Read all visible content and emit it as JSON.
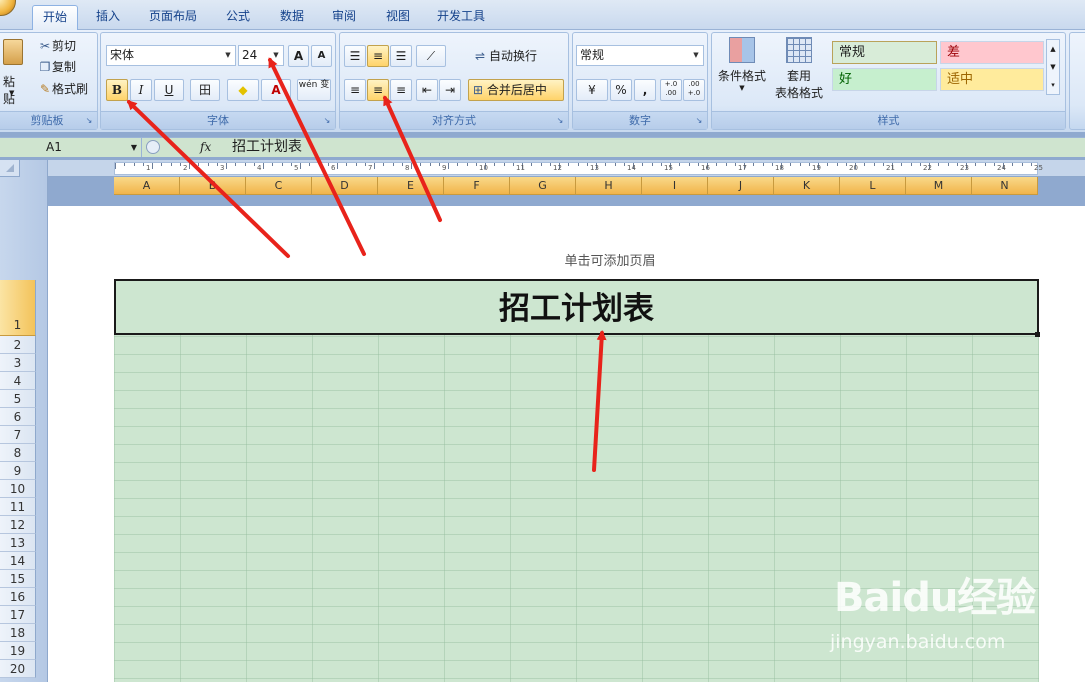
{
  "tabs": [
    "开始",
    "插入",
    "页面布局",
    "公式",
    "数据",
    "审阅",
    "视图",
    "开发工具"
  ],
  "clipboard": {
    "paste": "粘贴",
    "cut": "剪切",
    "copy": "复制",
    "format_painter": "格式刷",
    "label": "剪贴板"
  },
  "font": {
    "name": "宋体",
    "size": "24",
    "grow": "A",
    "shrink": "A",
    "bold": "B",
    "italic": "I",
    "underline": "U",
    "border": "田",
    "fill": "◆",
    "color": "A",
    "phonetic": "wén 变",
    "label": "字体"
  },
  "alignment": {
    "wrap_text": "自动换行",
    "merge_center": "合并后居中",
    "label": "对齐方式"
  },
  "number": {
    "format": "常规",
    "percent": "%",
    "comma": ",",
    "inc_decimal": "+.0 .00",
    "dec_decimal": ".00 +.0",
    "label": "数字"
  },
  "styles": {
    "conditional": "条件格式",
    "table_format_1": "套用",
    "table_format_2": "表格格式",
    "normal": "常规",
    "bad": "差",
    "good": "好",
    "neutral": "适中",
    "label": "样式"
  },
  "formula_bar": {
    "cell_ref": "A1",
    "fx": "fx",
    "content": "招工计划表"
  },
  "ruler_numbers": [
    "1",
    "2",
    "3",
    "4",
    "5",
    "6",
    "7",
    "8",
    "9",
    "10",
    "11",
    "12",
    "13",
    "14",
    "15",
    "16",
    "17",
    "18",
    "19",
    "20",
    "21",
    "22",
    "23",
    "24",
    "25"
  ],
  "columns": [
    "A",
    "B",
    "C",
    "D",
    "E",
    "F",
    "G",
    "H",
    "I",
    "J",
    "K",
    "L",
    "M",
    "N"
  ],
  "rows": [
    "1",
    "2",
    "3",
    "4",
    "5",
    "6",
    "7",
    "8",
    "9",
    "10",
    "11",
    "12",
    "13",
    "14",
    "15",
    "16",
    "17",
    "18",
    "19",
    "20"
  ],
  "header_hint": "单击可添加页眉",
  "cell_a1": "招工计划表",
  "watermark": {
    "logo": "Baidu经验",
    "url": "jingyan.baidu.com"
  },
  "colors": {
    "accent_arrow": "#e8231b",
    "sheet_fill": "#cde6d0",
    "header_highlight": "#f1b44a",
    "ribbon": "#dce8f7"
  }
}
